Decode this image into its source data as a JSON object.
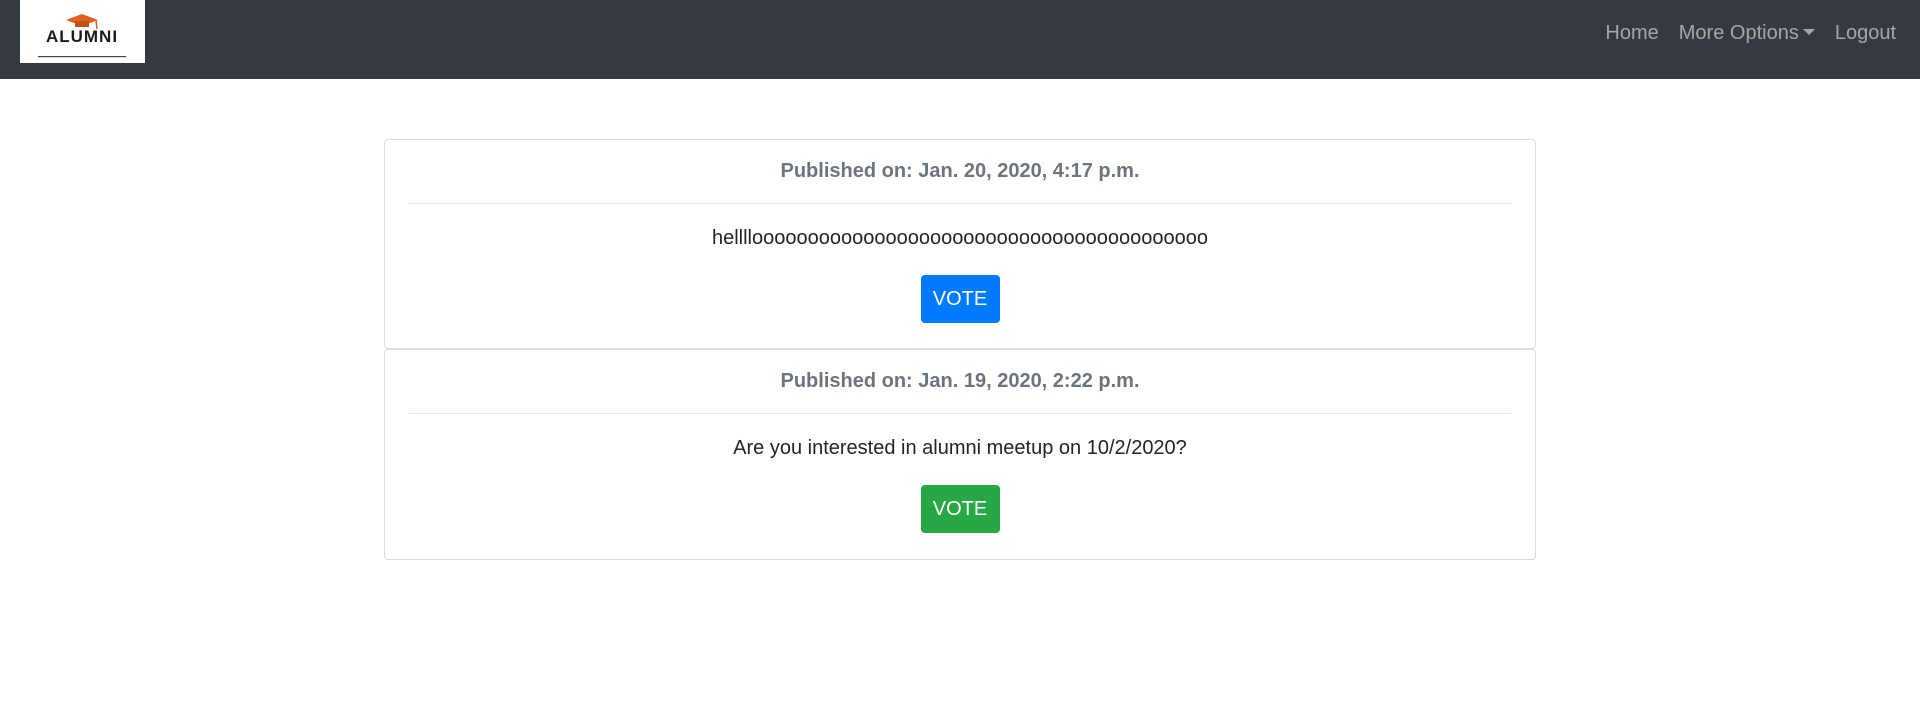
{
  "brand": {
    "logo_text": "ALUMNI"
  },
  "nav": {
    "home": "Home",
    "more_options": "More Options",
    "logout": "Logout"
  },
  "polls": [
    {
      "published": "Published on: Jan. 20, 2020, 4:17 p.m.",
      "question": "hellllooooooooooooooooooooooooooooooooooooooooo",
      "vote_label": "VOTE",
      "button_color": "#007bff"
    },
    {
      "published": "Published on: Jan. 19, 2020, 2:22 p.m.",
      "question": "Are you interested in alumni meetup on 10/2/2020?",
      "vote_label": "VOTE",
      "button_color": "#28a745"
    }
  ],
  "colors": {
    "navbar": "#343a40",
    "primary": "#007bff",
    "success": "#28a745",
    "logo_accent": "#e2601d"
  }
}
